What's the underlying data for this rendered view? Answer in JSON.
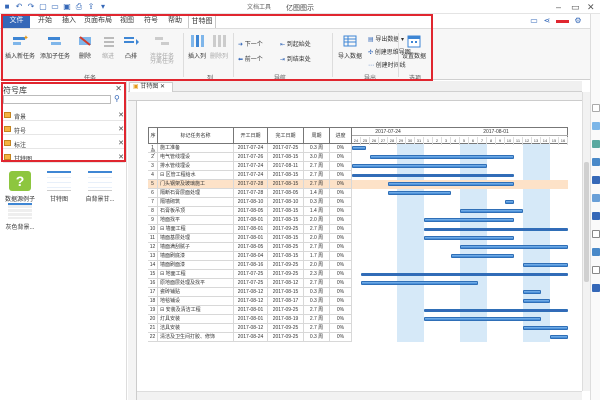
{
  "titlebar": {
    "title": "亿图图示",
    "tool_context": "文档工具"
  },
  "menu": {
    "tabs": [
      {
        "label": "文件"
      },
      {
        "label": "开始"
      },
      {
        "label": "插入"
      },
      {
        "label": "页面布局"
      },
      {
        "label": "视图"
      },
      {
        "label": "符号"
      },
      {
        "label": "帮助"
      },
      {
        "label": "甘特图"
      }
    ]
  },
  "ribbon": {
    "task_group": {
      "label": "任务",
      "buttons": [
        {
          "label": "插入新任务"
        },
        {
          "label": "添加子任务"
        },
        {
          "label": "删除"
        },
        {
          "label": "缩进"
        },
        {
          "label": "凸排"
        },
        {
          "label": "连接任务"
        },
        {
          "label": "分离任务"
        }
      ]
    },
    "column_group": {
      "label": "列",
      "buttons": [
        {
          "label": "插入列"
        },
        {
          "label": "删除列"
        }
      ]
    },
    "nav_group": {
      "label": "导航",
      "buttons": [
        {
          "label": "下一个"
        },
        {
          "label": "前一个"
        },
        {
          "label": "到起始处"
        },
        {
          "label": "到结束处"
        }
      ]
    },
    "export_group": {
      "label": "导出",
      "buttons": [
        {
          "label": "导入数据"
        },
        {
          "label": "导出数据"
        },
        {
          "label": "创建思维导图"
        },
        {
          "label": "创建时间线"
        }
      ]
    },
    "options_group": {
      "label": "选项",
      "buttons": [
        {
          "label": "设置数据"
        }
      ]
    }
  },
  "library": {
    "title": "符号库",
    "items": [
      {
        "label": "背景"
      },
      {
        "label": "符号"
      },
      {
        "label": "标注"
      },
      {
        "label": "甘特图"
      }
    ],
    "shapes": [
      {
        "label": "数据源例子"
      },
      {
        "label": "甘特图"
      },
      {
        "label": "自背景甘..."
      },
      {
        "label": "灰色背景..."
      }
    ]
  },
  "document": {
    "tab_label": "甘特图"
  },
  "gantt": {
    "columns": [
      "序号",
      "标记任务名称",
      "开工日期",
      "完工日期",
      "周期",
      "进度"
    ],
    "months": [
      "2017-07-24",
      "2017-08-01"
    ],
    "days": [
      "24",
      "25",
      "26",
      "27",
      "28",
      "29",
      "30",
      "31",
      "1",
      "2",
      "3",
      "4",
      "5",
      "6",
      "7",
      "8",
      "9",
      "10",
      "11",
      "12",
      "13",
      "14",
      "15",
      "16"
    ],
    "rows": [
      {
        "id": "1",
        "name": "施工准备",
        "start": "2017-07-24",
        "end": "2017-07-25",
        "dur": "0.3 周",
        "prog": "0%"
      },
      {
        "id": "2",
        "name": "电气管线埋设",
        "start": "2017-07-26",
        "end": "2017-08-15",
        "dur": "3.0 周",
        "prog": "0%"
      },
      {
        "id": "3",
        "name": "排水管线埋设",
        "start": "2017-07-24",
        "end": "2017-08-11",
        "dur": "2.7 周",
        "prog": "0%"
      },
      {
        "id": "4",
        "name": "⊟ 区管工程给水",
        "start": "2017-07-24",
        "end": "2017-08-15",
        "dur": "2.7 周",
        "prog": "0%"
      },
      {
        "id": "5",
        "name": "门头钢架及玻璃施工",
        "start": "2017-07-28",
        "end": "2017-08-15",
        "dur": "2.7 周",
        "prog": "0%"
      },
      {
        "id": "6",
        "name": "隔断石膏层面处理",
        "start": "2017-07-28",
        "end": "2017-08-05",
        "dur": "1.4 周",
        "prog": "0%"
      },
      {
        "id": "7",
        "name": "隔墙砌筑",
        "start": "2017-08-10",
        "end": "2017-08-10",
        "dur": "0.3 周",
        "prog": "0%"
      },
      {
        "id": "8",
        "name": "石膏板吊顶",
        "start": "2017-08-05",
        "end": "2017-08-15",
        "dur": "1.4 周",
        "prog": "0%"
      },
      {
        "id": "9",
        "name": "地面找平",
        "start": "2017-08-01",
        "end": "2017-08-15",
        "dur": "2.0 周",
        "prog": "0%"
      },
      {
        "id": "10",
        "name": "⊟ 墙面工程",
        "start": "2017-08-01",
        "end": "2017-09-25",
        "dur": "2.7 周",
        "prog": "0%"
      },
      {
        "id": "11",
        "name": "墙面基层处理",
        "start": "2017-08-01",
        "end": "2017-08-15",
        "dur": "2.0 周",
        "prog": "0%"
      },
      {
        "id": "12",
        "name": "墙面满刮腻子",
        "start": "2017-08-05",
        "end": "2017-08-25",
        "dur": "2.7 周",
        "prog": "0%"
      },
      {
        "id": "13",
        "name": "墙面刷底漆",
        "start": "2017-08-04",
        "end": "2017-08-15",
        "dur": "1.7 周",
        "prog": "0%"
      },
      {
        "id": "14",
        "name": "墙面刷面漆",
        "start": "2017-08-16",
        "end": "2017-09-25",
        "dur": "2.0 周",
        "prog": "0%"
      },
      {
        "id": "15",
        "name": "⊟ 地面工程",
        "start": "2017-07-25",
        "end": "2017-09-25",
        "dur": "2.3 周",
        "prog": "0%"
      },
      {
        "id": "16",
        "name": "原地面层处理及找平",
        "start": "2017-07-25",
        "end": "2017-08-12",
        "dur": "2.7 周",
        "prog": "0%"
      },
      {
        "id": "17",
        "name": "瓷砖铺贴",
        "start": "2017-08-12",
        "end": "2017-08-15",
        "dur": "0.3 周",
        "prog": "0%"
      },
      {
        "id": "18",
        "name": "地毯铺设",
        "start": "2017-08-12",
        "end": "2017-08-17",
        "dur": "0.3 周",
        "prog": "0%"
      },
      {
        "id": "19",
        "name": "⊟ 安装及清洁工程",
        "start": "2017-08-01",
        "end": "2017-09-25",
        "dur": "2.7 周",
        "prog": "0%"
      },
      {
        "id": "20",
        "name": "灯具安装",
        "start": "2017-08-01",
        "end": "2017-08-19",
        "dur": "2.7 周",
        "prog": "0%"
      },
      {
        "id": "21",
        "name": "洁具安装",
        "start": "2017-08-12",
        "end": "2017-09-25",
        "dur": "2.7 周",
        "prog": "0%"
      },
      {
        "id": "22",
        "name": "清洁及卫生间打胶、修饰",
        "start": "2017-08-24",
        "end": "2017-09-25",
        "dur": "0.3 周",
        "prog": "0%"
      }
    ],
    "bars": [
      {
        "row": 0,
        "start": 0,
        "len": 1.5
      },
      {
        "row": 1,
        "start": 2,
        "len": 16
      },
      {
        "row": 2,
        "start": 0,
        "len": 15
      },
      {
        "row": 3,
        "start": 0,
        "len": 18,
        "summary": true
      },
      {
        "row": 4,
        "start": 4,
        "len": 14
      },
      {
        "row": 5,
        "start": 4,
        "len": 7
      },
      {
        "row": 6,
        "start": 17,
        "len": 1
      },
      {
        "row": 7,
        "start": 12,
        "len": 7
      },
      {
        "row": 8,
        "start": 8,
        "len": 10
      },
      {
        "row": 9,
        "start": 8,
        "len": 16,
        "summary": true
      },
      {
        "row": 10,
        "start": 8,
        "len": 10
      },
      {
        "row": 11,
        "start": 12,
        "len": 12
      },
      {
        "row": 12,
        "start": 11,
        "len": 7
      },
      {
        "row": 13,
        "start": 19,
        "len": 5
      },
      {
        "row": 14,
        "start": 1,
        "len": 23,
        "summary": true
      },
      {
        "row": 15,
        "start": 1,
        "len": 13
      },
      {
        "row": 16,
        "start": 19,
        "len": 2
      },
      {
        "row": 17,
        "start": 19,
        "len": 3
      },
      {
        "row": 18,
        "start": 8,
        "len": 16,
        "summary": true
      },
      {
        "row": 19,
        "start": 8,
        "len": 13
      },
      {
        "row": 20,
        "start": 19,
        "len": 5
      },
      {
        "row": 21,
        "start": 22,
        "len": 2
      }
    ]
  }
}
